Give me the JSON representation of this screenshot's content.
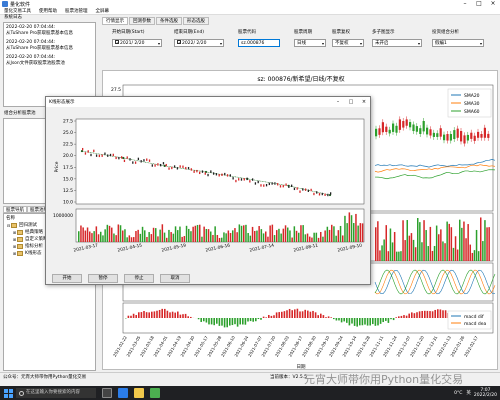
{
  "window": {
    "title": "量化软件"
  },
  "menu": [
    "量化交易工具",
    "使用帮助",
    "股票池管理",
    "全屏幕"
  ],
  "log_panel": {
    "title": "系统日志",
    "entries": [
      {
        "time": "2022-02-20 07:04:44:",
        "text": "从TuShare Pro获取股票基本信息"
      },
      {
        "time": "2022-02-20 07:04:44:",
        "text": "从TuShare Pro获取股票基本信息"
      },
      {
        "time": "2022-02-20 07:04:44:",
        "text": "从Json文件获取股票池股票池"
      }
    ]
  },
  "combo_panel": {
    "title": "组合分析股票池"
  },
  "nav": {
    "tabs": [
      "股票导航",
      "股票池导航"
    ],
    "tree_header": "名称",
    "tree": [
      {
        "label": "回归测试",
        "toggle": "⊟",
        "indent": 0
      },
      {
        "label": "经典策略",
        "toggle": "⊞",
        "indent": 1
      },
      {
        "label": "自定义策略",
        "toggle": "⊞",
        "indent": 1
      },
      {
        "label": "指标分析",
        "toggle": "⊞",
        "indent": 1
      },
      {
        "label": "K线形态",
        "toggle": "⊞",
        "indent": 1
      }
    ]
  },
  "main_tabs": [
    "行情显示",
    "回测参数",
    "条件选股",
    "形态选股"
  ],
  "controls": {
    "start_date_label": "开始日期(Start)",
    "start_date": "2021/ 2/20",
    "end_date_label": "结束日期(End)",
    "end_date": "2022/ 2/20",
    "stock_code_label": "股票代码",
    "stock_code": "sz.000876",
    "period_label": "股票周期",
    "period": "日线",
    "adjust_label": "股票复权",
    "adjust": "不复权",
    "display_label": "多子图显示",
    "display": "未开启",
    "analysis_label": "投资组合分析",
    "analysis": "假编1"
  },
  "main_chart": {
    "title": "sz: 000876/新希望/日线/不复权",
    "y_ticks": [
      "27.5",
      "25.0"
    ],
    "x_label": "日期",
    "x_ticks": [
      "2021-02-22",
      "2021-03-05",
      "2021-03-18",
      "2021-04-01",
      "2021-04-19",
      "2021-04-30",
      "2021-05-17",
      "2021-05-28",
      "2021-06-10",
      "2021-06-24",
      "2021-07-07",
      "2021-07-20",
      "2021-08-03",
      "2021-08-17",
      "2021-08-30",
      "2021-09-10",
      "2021-09-24",
      "2021-10-14",
      "2021-10-28",
      "2021-11-11",
      "2021-11-24",
      "2021-12-07",
      "2021-12-20",
      "2021-12-31",
      "2022-01-13",
      "2022-01-26",
      "2022-02-17"
    ],
    "legend_sma": [
      "SMA20",
      "SMA30",
      "SMA60"
    ],
    "legend_sma_colors": [
      "#1f77b4",
      "#ff7f0e",
      "#2ca02c"
    ],
    "legend_macd": [
      "macd dif",
      "macd dea"
    ]
  },
  "dialog": {
    "title": "K线形态展示",
    "ylabel": "Price",
    "y_ticks": [
      "27.5",
      "25.0",
      "22.5",
      "20.0",
      "17.5",
      "15.0",
      "12.5",
      "10.0"
    ],
    "vol_tick": "1000000",
    "x_ticks": [
      "2021-03-17",
      "2021-04-15",
      "2021-05-19",
      "2021-06-16",
      "2021-07-14",
      "2021-08-11",
      "2021-09-10"
    ],
    "buttons": [
      "开始",
      "暂停",
      "停止",
      "取消"
    ]
  },
  "chart_data": {
    "type": "line",
    "title": "",
    "ylabel": "Price",
    "x": [
      "2021-03-17",
      "2021-04-15",
      "2021-05-19",
      "2021-06-16",
      "2021-07-14",
      "2021-08-11",
      "2021-09-10"
    ],
    "series": [
      {
        "values": [
          21.0,
          19.5,
          17.8,
          16.5,
          15.0,
          13.5,
          11.5
        ]
      }
    ],
    "ylim": [
      10,
      27.5
    ]
  },
  "statusbar": {
    "left": "公众号：元宵大师带你用Python量化交易",
    "right": "当前版本：V2.5.5"
  },
  "taskbar": {
    "search_placeholder": "在这里输入你要搜索的内容",
    "temp": "0°C",
    "lang": "英",
    "time": "7:07",
    "date": "2022/2/20"
  },
  "watermark": "元宵大师带你用Python量化交易"
}
